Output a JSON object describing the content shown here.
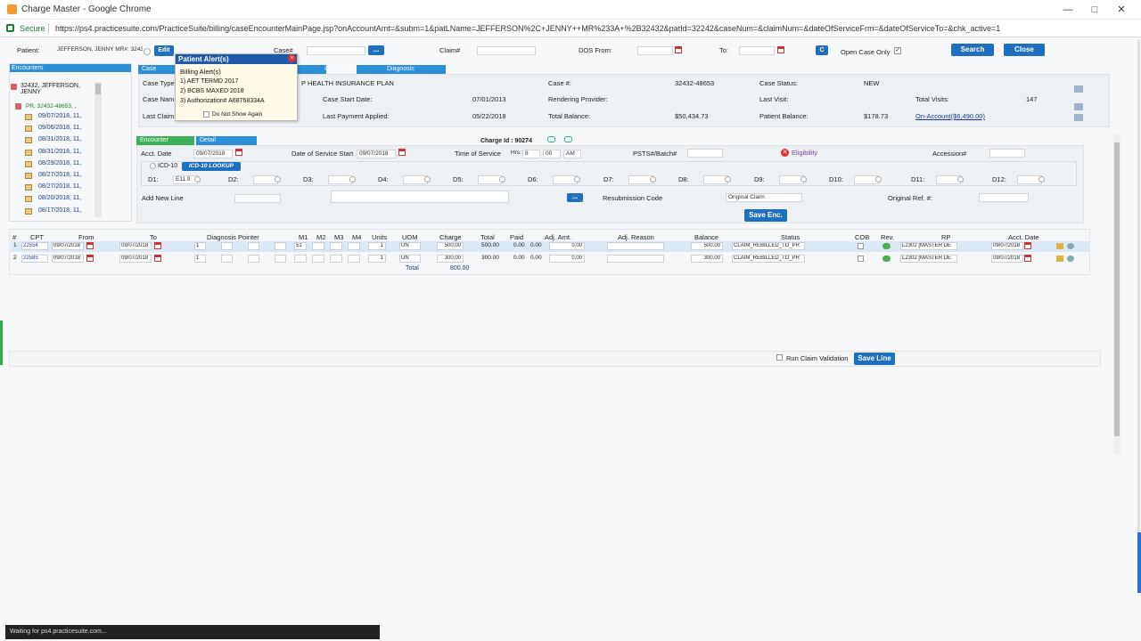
{
  "window": {
    "title": "Charge Master - Google Chrome",
    "secure_label": "Secure",
    "url": "https://ps4.practicesuite.com/PracticeSuite/billing/caseEncounterMainPage.jsp?onAccountAmt=&subm=1&patLName=JEFFERSON%2C+JENNY++MR%233A+%2B32432&patId=32242&caseNum=&claimNum=&dateOfServiceFrm=&dateOfServiceTo=&chk_active=1"
  },
  "search": {
    "patient_label": "Patient:",
    "patient_value": "JEFFERSON, JENNY  MR#: 32432",
    "edit_label": "Edit",
    "case_label": "Case#",
    "claim_label": "Claim#",
    "dos_from_label": "DOS From:",
    "to_label": "To:",
    "c_label": "C",
    "open_case_only_label": "Open Case Only",
    "search_label": "Search",
    "close_label": "Close",
    "ellipsis": "..."
  },
  "sidebar": {
    "header": "Encounters",
    "patient_node": "32432, JEFFERSON, JENNY",
    "case_node": "PR, 32432-48653, ,",
    "dates": [
      "09/07/2018, 11,",
      "09/06/2018, 11,",
      "08/31/2018, 11,",
      "08/31/2018, 11,",
      "08/29/2018, 11,",
      "08/27/2018, 11,",
      "08/27/2018, 11,",
      "08/20/2018, 11,",
      "08/17/2018, 11,"
    ]
  },
  "tabs": {
    "case": "Case",
    "insurance": "Insurance",
    "diagnosis": "Diagnosis",
    "encounter": "Encounter",
    "detail": "Detail"
  },
  "case_info": {
    "case_type_label": "Case Type",
    "case_name_label": "Case Nam",
    "last_claim_label": "Last Claim",
    "insurance_plan": "P HEALTH INSURANCE PLAN",
    "case_start_label": "Case Start Date:",
    "case_start_value": "07/01/2013",
    "last_payment_label": "Last Payment Applied:",
    "last_payment_value": "05/22/2018",
    "case_num_label": "Case #:",
    "case_num_value": "32432-48653",
    "rendering_label": "Rendering Provider:",
    "total_balance_label": "Total Balance:",
    "total_balance_value": "$50,434.73",
    "case_status_label": "Case Status:",
    "case_status_value": "NEW",
    "last_visit_label": "Last Visit:",
    "patient_balance_label": "Patient Balance:",
    "patient_balance_value": "$178.73",
    "total_visits_label": "Total Visits:",
    "total_visits_value": "147",
    "on_account_value": "On-Account($6,490.00)"
  },
  "encounter": {
    "charge_id_label": "Charge Id : 90274",
    "acct_date_label": "Acct. Date",
    "acct_date_value": "09/07/2018",
    "dos_start_label": "Date of Service Start",
    "dos_start_value": "09/07/2018",
    "time_label": "Time of Service",
    "hrs_label": "Hrs:",
    "hrs_value": "8",
    "min_value": "00",
    "ampm_value": "AM",
    "psts_label": "PSTS#/Batch#",
    "eligibility_label": "Eligibility",
    "accession_label": "Accession#",
    "icd_label": "ICD-10",
    "icd_lookup_label": "ICD-10 LOOKUP",
    "dx": [
      {
        "label": "D1:",
        "value": "E11.9"
      },
      {
        "label": "D2:",
        "value": ""
      },
      {
        "label": "D3:",
        "value": ""
      },
      {
        "label": "D4:",
        "value": ""
      },
      {
        "label": "D5:",
        "value": ""
      },
      {
        "label": "D6:",
        "value": ""
      },
      {
        "label": "D7:",
        "value": ""
      },
      {
        "label": "D8:",
        "value": ""
      },
      {
        "label": "D9:",
        "value": ""
      },
      {
        "label": "D10:",
        "value": ""
      },
      {
        "label": "D11:",
        "value": ""
      },
      {
        "label": "D12:",
        "value": ""
      }
    ],
    "add_new_line_label": "Add New Line",
    "resubmission_label": "Resubmission Code",
    "resubmission_value": "Original Claim",
    "original_ref_label": "Original Ref. #:",
    "save_enc_label": "Save Enc."
  },
  "grid": {
    "headers": [
      "#",
      "CPT",
      "From",
      "To",
      "Diagnosis Pointer",
      "M1",
      "M2",
      "M3",
      "M4",
      "Units",
      "UOM",
      "Charge",
      "Total",
      "Paid",
      "Adj. Amt.",
      "Adj. Reason",
      "Balance",
      "Status",
      "COB",
      "Rev.",
      "RP",
      "Acct. Date"
    ],
    "rows": [
      {
        "num": "1",
        "cpt": "22554",
        "from": "09/07/2018",
        "to": "09/07/2018",
        "ptr1": "1",
        "m1": "51",
        "units": "1",
        "uom": "UN",
        "charge": "500.00",
        "total": "500.00",
        "paid": "0.00",
        "paid2": "0.00",
        "adj": "0.00",
        "balance": "500.00",
        "status": "CLAIM_REBILLED_TO_PR",
        "rp": "L2302 [MASTER DE",
        "acct_date": "09/07/2018"
      },
      {
        "num": "2",
        "cpt": "22585",
        "from": "09/07/2018",
        "to": "09/07/2018",
        "ptr1": "1",
        "m1": "",
        "units": "1",
        "uom": "UN",
        "charge": "300.00",
        "total": "300.00",
        "paid": "0.00",
        "paid2": "0.00",
        "adj": "0.00",
        "balance": "300.00",
        "status": "CLAIM_REBILLED_TO_PR",
        "rp": "L2302 [MASTER DE",
        "acct_date": "09/07/2018"
      }
    ],
    "total_label": "Total",
    "total_value": "800.00"
  },
  "footer": {
    "run_validation_label": "Run Claim Validation",
    "save_line_label": "Save Line"
  },
  "popup": {
    "title": "Patient Alert(s)",
    "section": "Billing Alert(s)",
    "items": [
      "1) AET TERMD 2017",
      "2) BCBS MAXED 2018",
      "3) Authorization# A68768334A"
    ],
    "dont_show_label": "Do Not Show Again"
  },
  "status": {
    "text": "Waiting for ps4.practicesuite.com..."
  }
}
